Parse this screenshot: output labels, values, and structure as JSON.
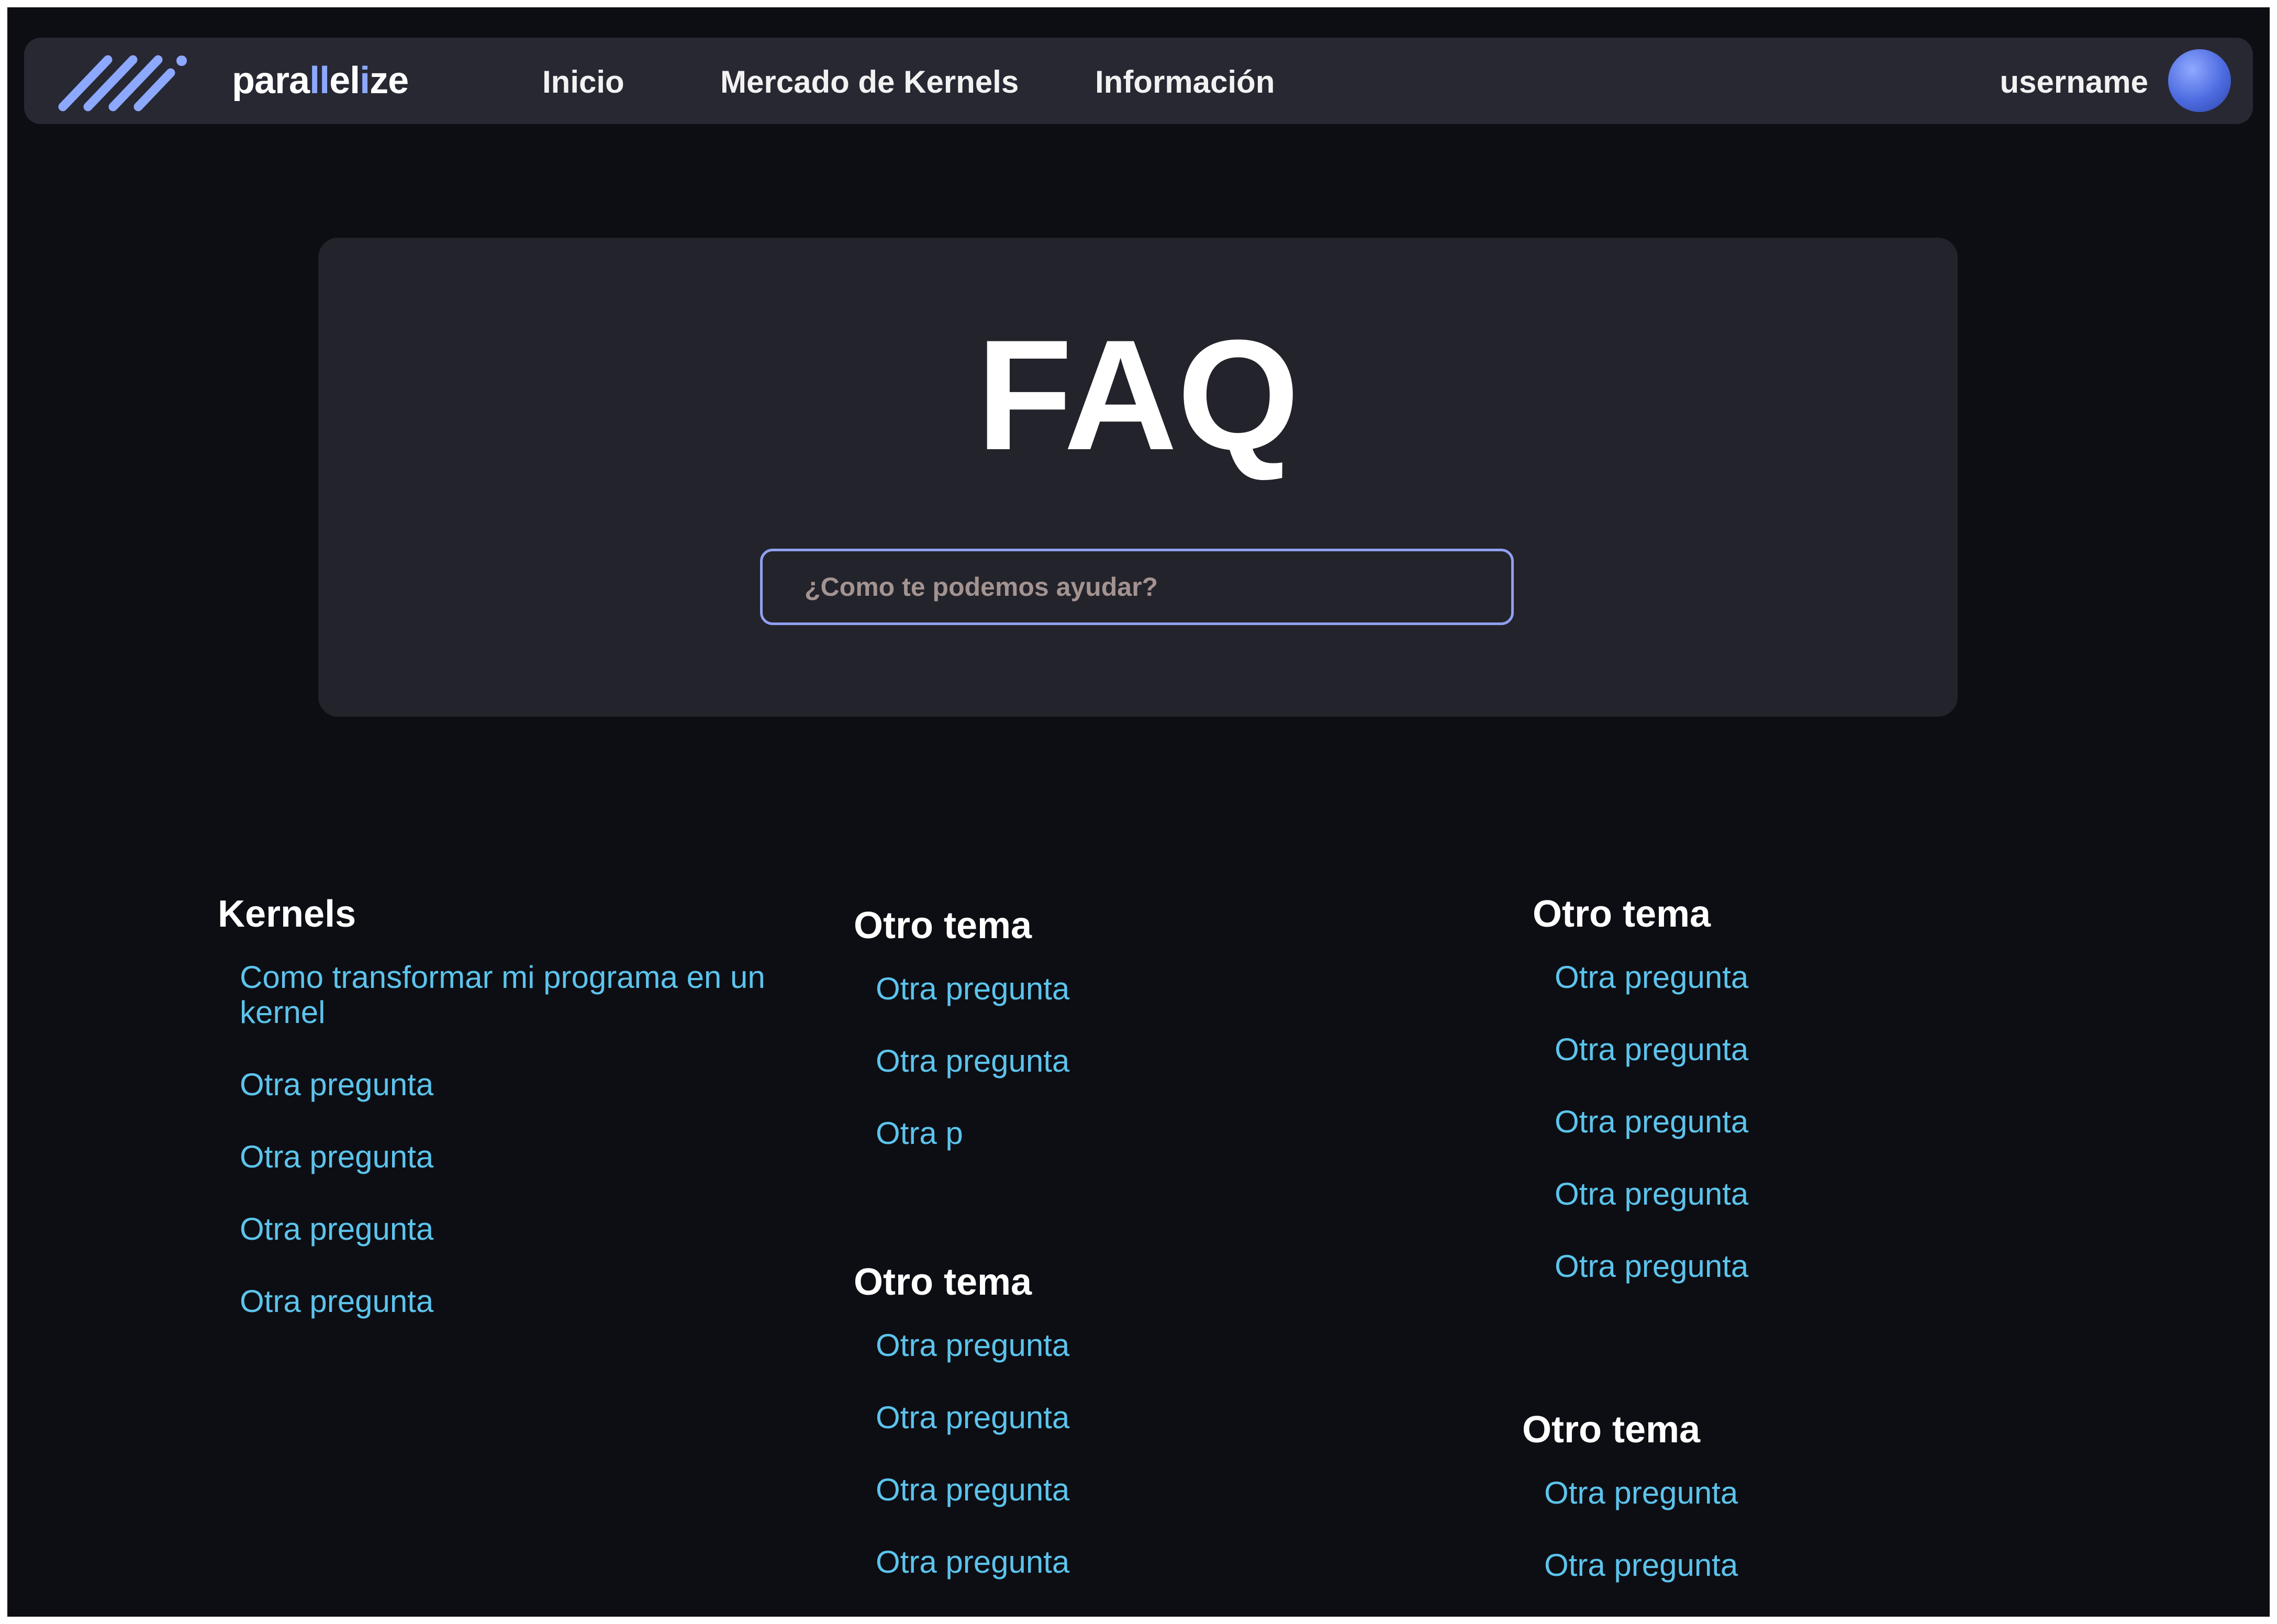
{
  "navbar": {
    "logo": {
      "icon": "parallelize-logo-icon",
      "brand_pre": "para",
      "brand_hl1": "ll",
      "brand_mid": "el",
      "brand_hl2": "i",
      "brand_post": "ze"
    },
    "links": [
      "Inicio",
      "Mercado de Kernels",
      "Información"
    ],
    "username": "username",
    "avatar_icon": "user-avatar-icon"
  },
  "hero": {
    "title": "FAQ",
    "search": {
      "placeholder": "¿Como te podemos ayudar?",
      "value": ""
    }
  },
  "faq": {
    "sections": [
      {
        "title": "Kernels",
        "questions": [
          "Como transformar mi programa en un kernel",
          "Otra pregunta",
          "Otra pregunta",
          "Otra pregunta",
          "Otra pregunta"
        ]
      },
      {
        "title": "Otro tema",
        "questions": [
          "Otra pregunta",
          "Otra pregunta",
          "Otra p"
        ]
      },
      {
        "title": "Otro tema",
        "questions": [
          "Otra pregunta",
          "Otra pregunta",
          "Otra pregunta",
          "Otra pregunta"
        ]
      },
      {
        "title": "Otro tema",
        "questions": [
          "Otra pregunta",
          "Otra pregunta",
          "Otra pregunta",
          "Otra pregunta",
          "Otra pregunta"
        ]
      },
      {
        "title": "Otro tema",
        "questions": [
          "Otra pregunta",
          "Otra pregunta"
        ]
      }
    ]
  },
  "colors": {
    "background": "#0d0e14",
    "navbar": "#282833",
    "card": "#23232b",
    "accent": "#8ca8ff",
    "link": "#5cc4ec",
    "search_border": "#8fa0f0"
  }
}
